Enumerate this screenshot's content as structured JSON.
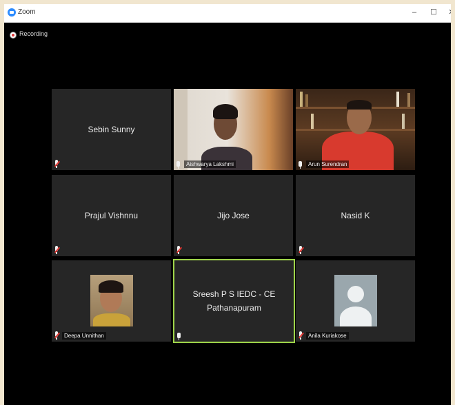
{
  "window": {
    "title": "Zoom",
    "controls": {
      "minimize": "–",
      "maximize": "☐",
      "close": "✕"
    }
  },
  "recording": {
    "label": "Recording"
  },
  "tiles": [
    {
      "name": "Sebin Sunny",
      "label": "",
      "muted": true,
      "type": "name"
    },
    {
      "name": "",
      "label": "Aishwarya Lakshmi",
      "muted": false,
      "type": "video"
    },
    {
      "name": "",
      "label": "Arun Surendran",
      "muted": false,
      "type": "video"
    },
    {
      "name": "Prajul Vishnnu",
      "label": "",
      "muted": true,
      "type": "name"
    },
    {
      "name": "Jijo Jose",
      "label": "",
      "muted": true,
      "type": "name"
    },
    {
      "name": "Nasid K",
      "label": "",
      "muted": true,
      "type": "name"
    },
    {
      "name": "",
      "label": "Deepa Unnithan",
      "muted": true,
      "type": "avatar-photo"
    },
    {
      "name": "Sreesh P S IEDC - CE Pathanapuram",
      "label": "",
      "muted": false,
      "type": "name",
      "active": true
    },
    {
      "name": "",
      "label": "Anila Kuriakose",
      "muted": true,
      "type": "avatar-default"
    }
  ],
  "colors": {
    "active_speaker_border": "#9ed449",
    "muted_icon": "#e53935",
    "tile_background": "#262626",
    "window_background": "#000000"
  }
}
